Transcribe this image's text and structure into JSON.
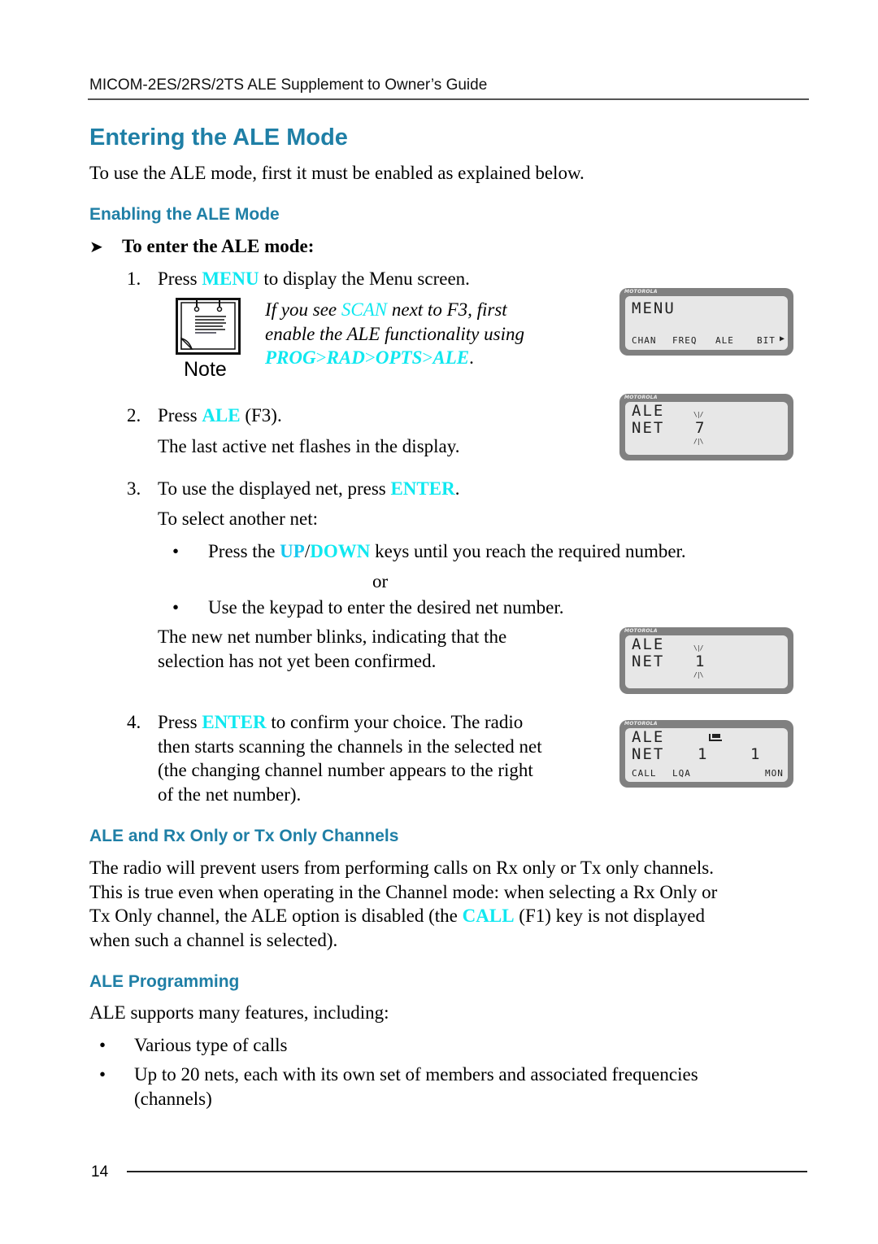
{
  "header": {
    "running_title": "MICOM-2ES/2RS/2TS ALE Supplement to Owner’s Guide"
  },
  "section": {
    "title": "Entering the ALE Mode",
    "intro": "To use the ALE mode, first it must be enabled as explained below."
  },
  "enabling": {
    "title": "Enabling the ALE Mode",
    "procedure_title": "To enter the ALE mode:",
    "procedure_icon": "arrow-right-icon",
    "step1": {
      "num": "1.",
      "pre": "Press ",
      "key": "MENU",
      "post": " to display the Menu screen."
    },
    "note": {
      "label": "Note",
      "icon": "notepad-icon",
      "line1_pre": "If you see ",
      "line1_key": "SCAN",
      "line1_post": " next to F3, first",
      "line2": "enable the ALE functionality using",
      "path": [
        "PROG",
        "RAD",
        "OPTS",
        "ALE"
      ],
      "path_sep": ">",
      "path_end": "."
    },
    "step2": {
      "num": "2.",
      "pre": "Press ",
      "key": "ALE",
      "post": " (F3).",
      "detail": "The last active net flashes in the display."
    },
    "step3": {
      "num": "3.",
      "pre": "To use the displayed net, press ",
      "key": "ENTER",
      "post": ".",
      "sub": "To select another net:",
      "bullet1_pre": "Press the ",
      "bullet1_key1": "UP",
      "bullet1_sep": "/",
      "bullet1_key2": "DOWN",
      "bullet1_post": " keys until you reach the required number.",
      "or": "or",
      "bullet2": "Use the keypad to enter the desired net number.",
      "detail_line1": "The new net number blinks, indicating that the",
      "detail_line2": "selection has not yet been confirmed."
    },
    "step4": {
      "num": "4.",
      "pre": "Press ",
      "key": "ENTER",
      "line1_post": " to confirm your choice. The radio",
      "line2": "then starts scanning the channels in the selected net",
      "line3": "(the changing channel number appears to the right",
      "line4": "of the net number)."
    }
  },
  "displays": {
    "brand": "MOTOROLA",
    "menu": {
      "title": "MENU",
      "softkeys": [
        "CHAN",
        "FREQ",
        "ALE",
        "BIT"
      ],
      "more_icon": "triangle-right-icon"
    },
    "net_flash_7": {
      "line1": "ALE",
      "line2": "NET",
      "net": "7",
      "flash_top": "\\|/",
      "flash_bottom": "/|\\"
    },
    "net_flash_1": {
      "line1": "ALE",
      "line2": "NET",
      "net": "1",
      "flash_top": "\\|/",
      "flash_bottom": "/|\\"
    },
    "net_scan": {
      "line1": "ALE",
      "line2": "NET",
      "net": "1",
      "channel": "1",
      "status_icon": "scan-indicator-icon",
      "softkeys": [
        "CALL",
        "LQA",
        "MON"
      ]
    }
  },
  "rx_tx": {
    "title": "ALE and Rx Only or Tx Only Channels",
    "line1": "The radio will prevent users from performing calls on Rx only or Tx only channels.",
    "line2": "This is true even when operating in the Channel mode: when selecting a Rx Only or",
    "line3_pre": "Tx Only channel, the ALE option is disabled (the ",
    "line3_key": "CALL",
    "line3_post": " (F1) key is not displayed",
    "line4": "when such a channel is selected)."
  },
  "programming": {
    "title": "ALE Programming",
    "intro": "ALE supports many features, including:",
    "bullets": [
      "Various type of calls",
      "Up to 20 nets, each with its own set of members and associated frequencies",
      "(channels)"
    ]
  },
  "footer": {
    "page_number": "14"
  },
  "colors": {
    "heading": "#1f7fa6",
    "key": "#10e8f0",
    "lcd_frame": "#808080",
    "lcd_screen": "#e7e7e7"
  }
}
